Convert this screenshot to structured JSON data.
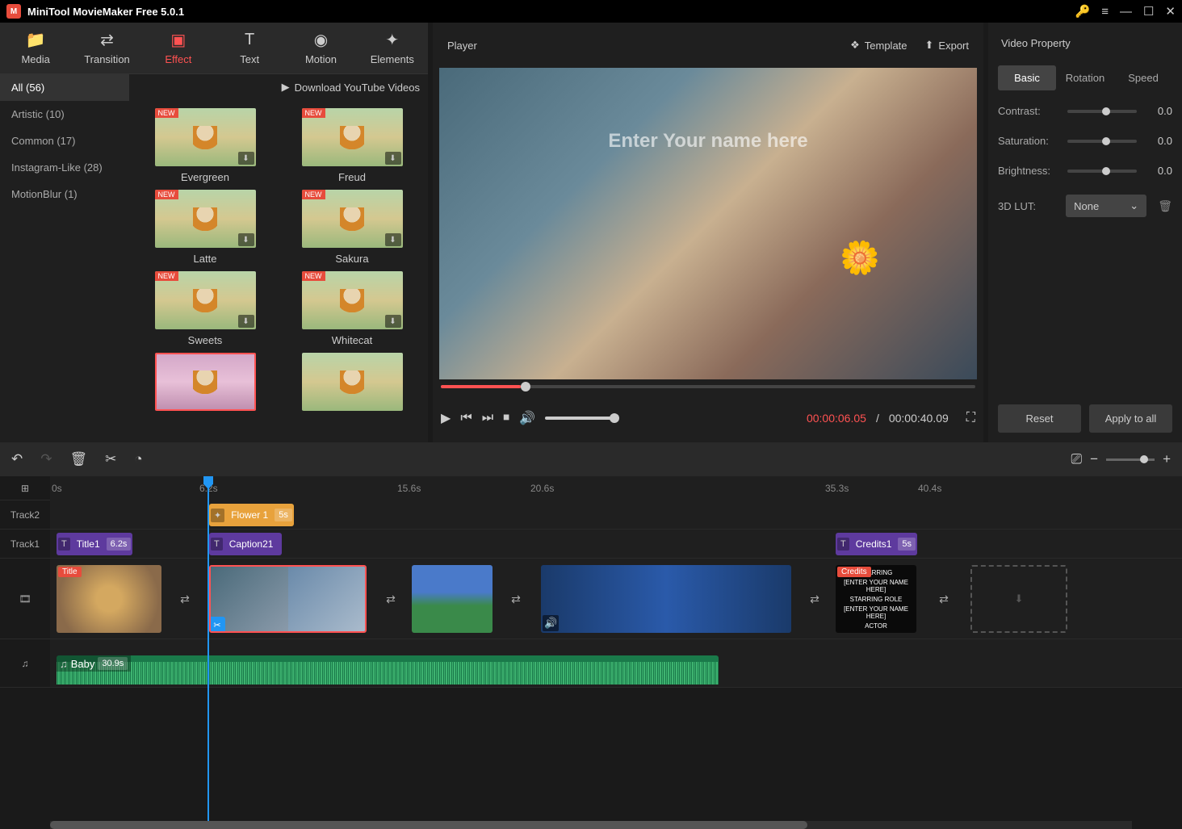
{
  "app": {
    "title": "MiniTool MovieMaker Free 5.0.1"
  },
  "topTabs": {
    "media": "Media",
    "transition": "Transition",
    "effect": "Effect",
    "text": "Text",
    "motion": "Motion",
    "elements": "Elements"
  },
  "categories": {
    "all": "All (56)",
    "artistic": "Artistic (10)",
    "common": "Common (17)",
    "instagram": "Instagram-Like (28)",
    "motionblur": "MotionBlur (1)"
  },
  "dlBar": "Download YouTube Videos",
  "effects": {
    "e1": "Evergreen",
    "e2": "Freud",
    "e3": "Latte",
    "e4": "Sakura",
    "e5": "Sweets",
    "e6": "Whitecat",
    "new": "NEW"
  },
  "player": {
    "title": "Player",
    "template": "Template",
    "export": "Export",
    "overlay": "Enter Your name here",
    "current": "00:00:06.05",
    "sep": "/",
    "total": "00:00:40.09"
  },
  "props": {
    "title": "Video Property",
    "basic": "Basic",
    "rotation": "Rotation",
    "speed": "Speed",
    "contrast": "Contrast:",
    "saturation": "Saturation:",
    "brightness": "Brightness:",
    "lut": "3D LUT:",
    "lutVal": "None",
    "val": "0.0",
    "reset": "Reset",
    "apply": "Apply to all"
  },
  "ruler": {
    "m0": "0s",
    "m1": "6.2s",
    "m2": "15.6s",
    "m3": "20.6s",
    "m4": "35.3s",
    "m5": "40.4s"
  },
  "tracks": {
    "t2": "Track2",
    "t1": "Track1",
    "flower": "Flower 1",
    "flowerDur": "5s",
    "title1": "Title1",
    "title1Dur": "6.2s",
    "caption": "Caption21",
    "credits": "Credits1",
    "creditsDur": "5s",
    "vTitle": "Title",
    "vCredits": "Credits",
    "creditText1": "STARRING",
    "creditText2": "[ENTER YOUR NAME HERE]",
    "creditText3": "STARRING ROLE",
    "creditText4": "[ENTER YOUR NAME HERE]",
    "creditText5": "ACTOR",
    "audioName": "Baby",
    "audioDur": "30.9s"
  }
}
